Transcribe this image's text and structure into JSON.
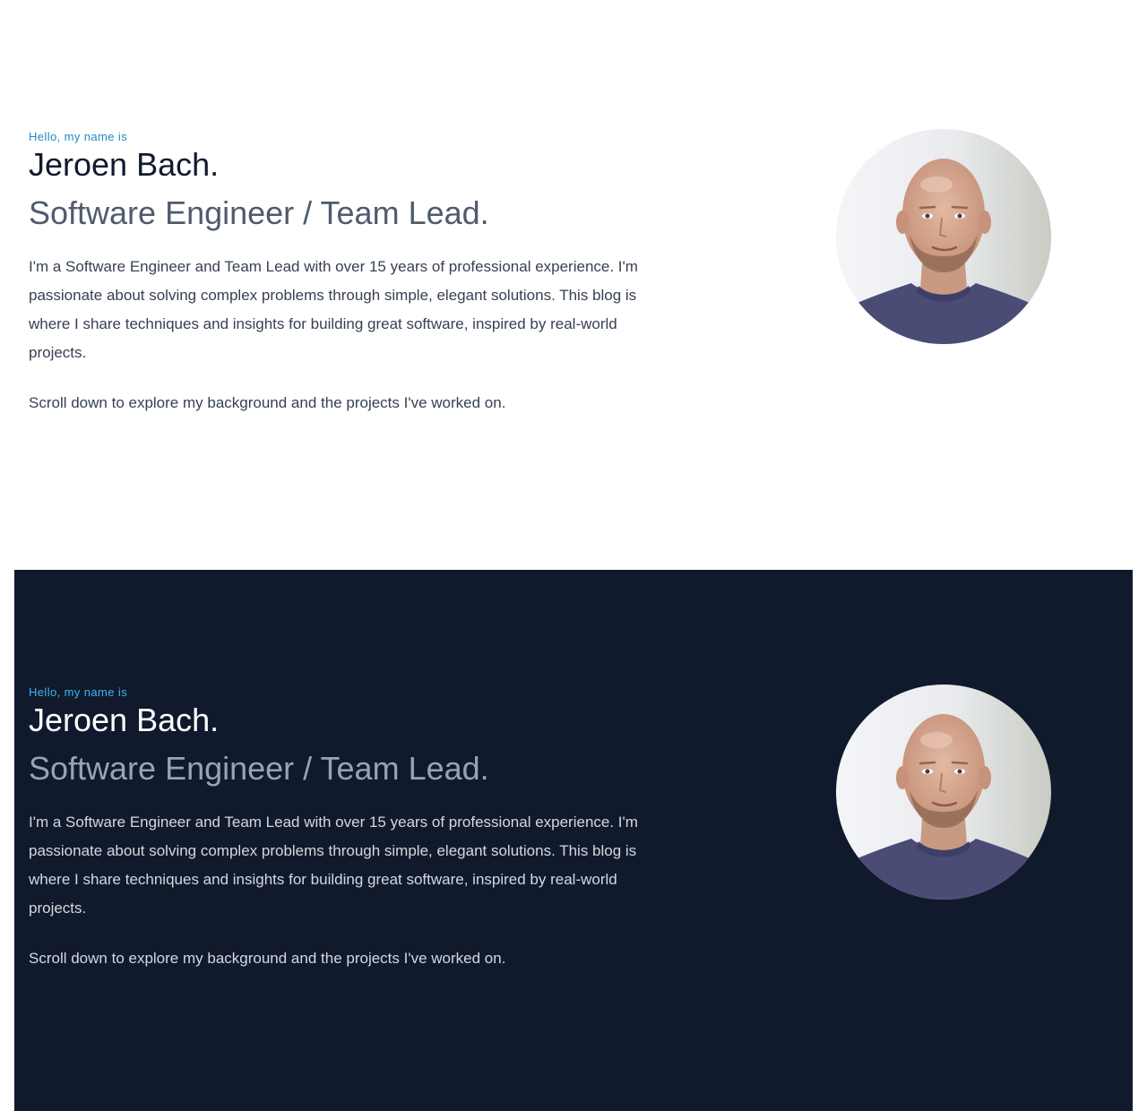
{
  "light": {
    "eyebrow": "Hello, my name is",
    "name": "Jeroen Bach.",
    "role": "Software Engineer / Team Lead.",
    "intro": "I'm a Software Engineer and Team Lead with over 15 years of professional experience. I'm passionate about solving complex problems through simple, elegant solutions. This blog is where I share techniques and insights for building great software, inspired by real-world projects.",
    "scroll_note": "Scroll down to explore my background and the projects I've worked on."
  },
  "dark": {
    "eyebrow": "Hello, my name is",
    "name": "Jeroen Bach.",
    "role": "Software Engineer / Team Lead.",
    "intro": "I'm a Software Engineer and Team Lead with over 15 years of professional experience. I'm passionate about solving complex problems through simple, elegant solutions. This blog is where I share techniques and insights for building great software, inspired by real-world projects.",
    "scroll_note": "Scroll down to explore my background and the projects I've worked on."
  },
  "colors": {
    "light_background": "#ffffff",
    "dark_background": "#111a2c",
    "light_accent": "#1f8bc4",
    "dark_accent": "#3eb6ef"
  },
  "avatar_icon": "profile-photo"
}
